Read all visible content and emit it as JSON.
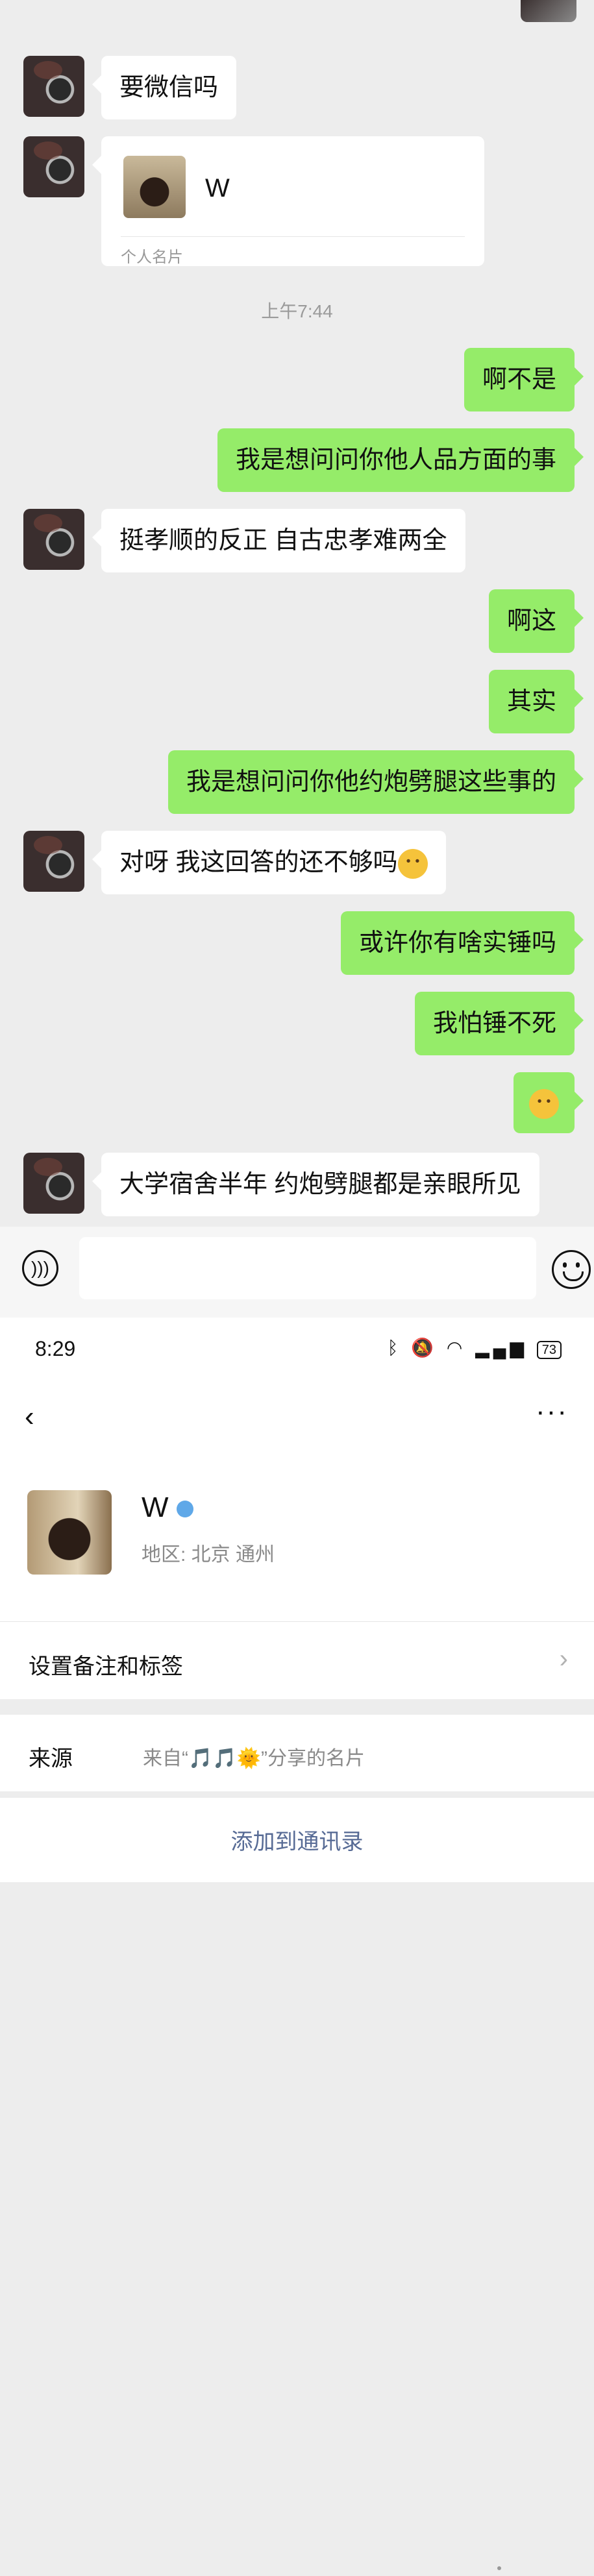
{
  "chat": {
    "messages": [
      {
        "from": "other",
        "text": "要微信吗"
      },
      {
        "from": "other",
        "type": "contact_card",
        "name": "W",
        "label": "个人名片"
      },
      {
        "from": "system",
        "text": "上午7:44"
      },
      {
        "from": "me",
        "text": "啊不是"
      },
      {
        "from": "me",
        "text": "我是想问问你他人品方面的事"
      },
      {
        "from": "other",
        "text": "挺孝顺的反正 自古忠孝难两全"
      },
      {
        "from": "me",
        "text": "啊这"
      },
      {
        "from": "me",
        "text": "其实"
      },
      {
        "from": "me",
        "text": "我是想问问你他约炮劈腿这些事的"
      },
      {
        "from": "other",
        "text": "对呀 我这回答的还不够吗",
        "emoji": "crying-laughing"
      },
      {
        "from": "me",
        "text": "或许你有啥实锤吗"
      },
      {
        "from": "me",
        "text": "我怕锤不死"
      },
      {
        "from": "me",
        "text": "",
        "emoji": "awkward-face"
      },
      {
        "from": "other",
        "text": "大学宿舍半年 约炮劈腿都是亲眼所见"
      }
    ]
  },
  "status": {
    "time": "8:29",
    "battery": "73"
  },
  "profile": {
    "name": "W",
    "region": "地区:  北京  通州",
    "set_remark_label": "设置备注和标签",
    "source_label": "来源",
    "source_value": "来自“🎵🎵🌞”分享的名片",
    "add_button": "添加到通讯录"
  }
}
